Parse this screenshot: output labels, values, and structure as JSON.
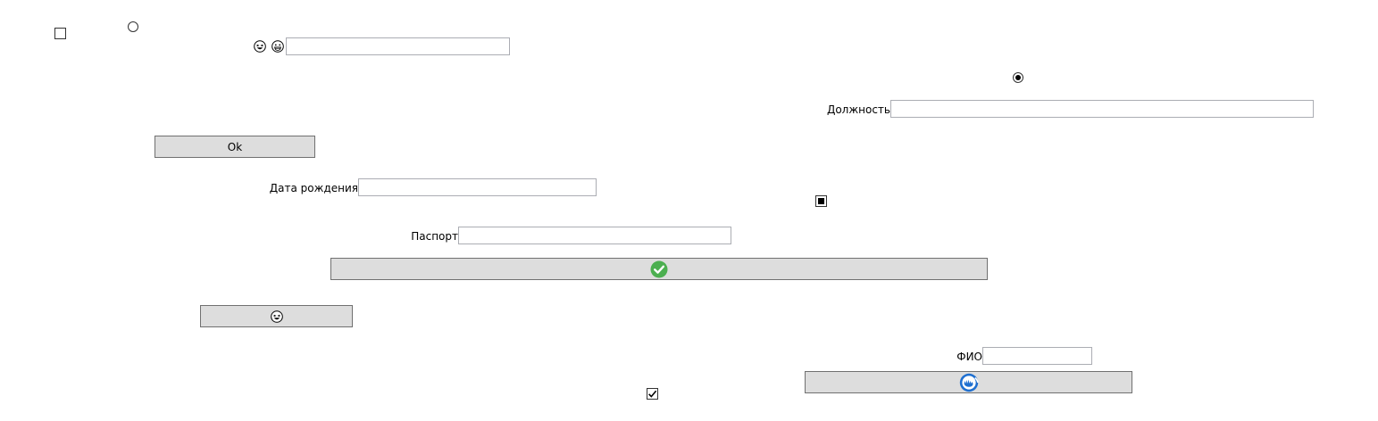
{
  "form": {
    "position_label": "Должность",
    "position_value": "",
    "birthdate_label": "Дата рождения",
    "birthdate_value": "",
    "passport_label": "Паспорт",
    "passport_value": "",
    "fio_label": "ФИО",
    "fio_value": "",
    "top_field_value": ""
  },
  "buttons": {
    "ok_label": "Ok",
    "check_button_icon": "green-checkmark-icon",
    "emoji_button_icon": "laughing-face-icon",
    "blue_button_icon": "blue-circle-logo-icon"
  },
  "controls": {
    "checkbox_top_left": "unchecked",
    "checkbox_middle": "indeterminate",
    "checkbox_bottom": "checked",
    "radio_top": "unselected",
    "radio_right": "selected"
  },
  "icons": {
    "emoji_1": "laughing-face-icon",
    "emoji_2": "grinning-face-icon"
  },
  "colors": {
    "button_bg": "#dddddd",
    "button_border": "#707070",
    "input_border": "#abadb3",
    "check_green": "#4caf50",
    "logo_blue": "#1e6fd0"
  }
}
